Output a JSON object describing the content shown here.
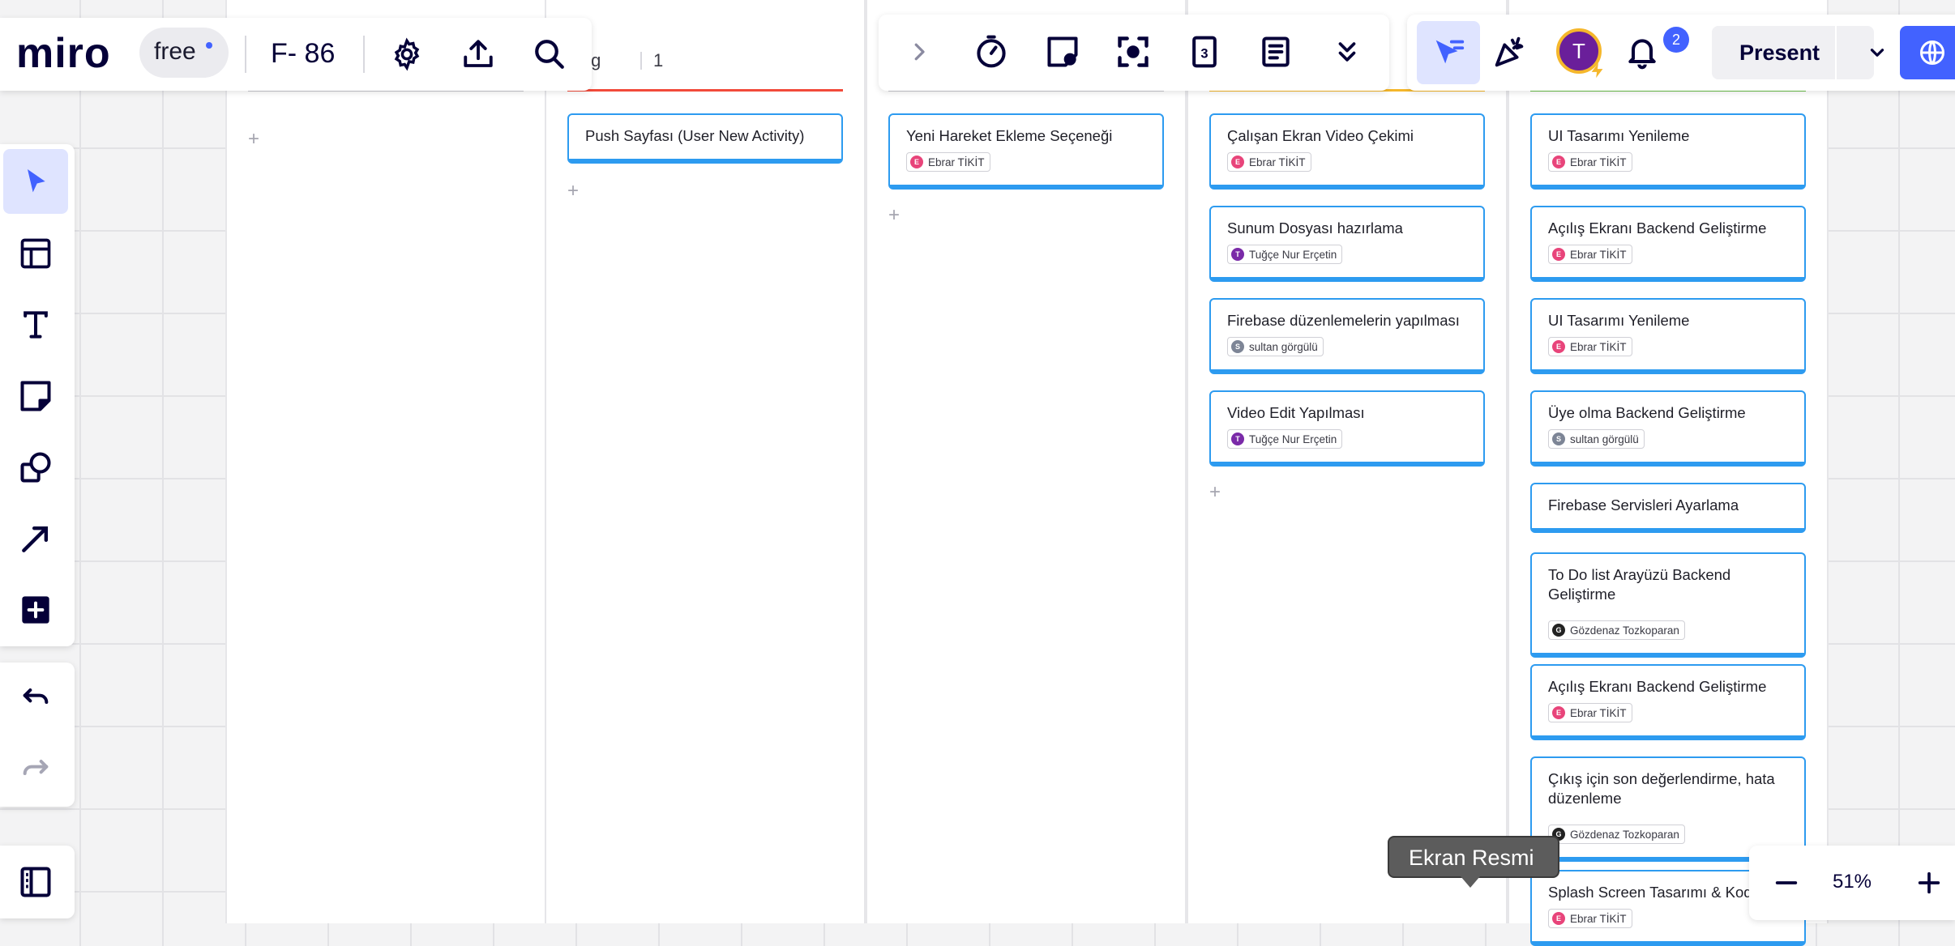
{
  "app": {
    "logo": "miro",
    "plan_badge": "free",
    "board_name": "F- 86"
  },
  "topbar_icons": [
    "settings-icon",
    "upload-icon",
    "search-icon"
  ],
  "collab_toolbar": {
    "icons": [
      "chevron-right-icon",
      "timer-icon",
      "sticky-vote-icon",
      "focus-icon",
      "card-count-icon",
      "notes-icon",
      "chevron-double-down-icon"
    ],
    "avatar_letter": "T",
    "notification_count": "2",
    "present_label": "Present"
  },
  "columns": [
    {
      "title": "",
      "count": "",
      "color": "#c7c7cf",
      "cards": []
    },
    {
      "title": "cklog",
      "count": "1",
      "color": "#f24a3a",
      "cards": [
        {
          "title": "Push Sayfası (User New Activity)",
          "assignee": ""
        }
      ]
    },
    {
      "title": "",
      "count": "",
      "color": "#c7c7cf",
      "cards": [
        {
          "title": "Yeni Hareket Ekleme Seçeneği",
          "assignee": "Ebrar TİKİT"
        }
      ]
    },
    {
      "title": "",
      "count": "",
      "color": "#f5b72b",
      "cards": [
        {
          "title": "Çalışan Ekran Video Çekimi",
          "assignee": "Ebrar TİKİT"
        },
        {
          "title": "Sunum Dosyası hazırlama",
          "assignee": "Tuğçe Nur Erçetin"
        },
        {
          "title": "Firebase düzenlemelerin yapılması",
          "assignee": "sultan görgülü"
        },
        {
          "title": "Video Edit Yapılması",
          "assignee": "Tuğçe Nur Erçetin"
        }
      ]
    },
    {
      "title": "",
      "count": "",
      "color": "#6cc24a",
      "cards": [
        {
          "title": "UI Tasarımı Yenileme",
          "assignee": "Ebrar TİKİT"
        },
        {
          "title": "Açılış Ekranı Backend Geliştirme",
          "assignee": "Ebrar TİKİT"
        },
        {
          "title": "UI Tasarımı Yenileme",
          "assignee": "Ebrar TİKİT"
        },
        {
          "title": "Üye olma Backend Geliştirme",
          "assignee": "sultan görgülü"
        },
        {
          "title": "Firebase Servisleri Ayarlama",
          "assignee": ""
        },
        {
          "title": "To Do list Arayüzü Backend Geliştirme",
          "assignee": "Gözdenaz Tozkoparan"
        },
        {
          "title": "Açılış Ekranı Backend Geliştirme",
          "assignee": "Ebrar TİKİT"
        },
        {
          "title": "Çıkış için son değerlendirme, hata düzenleme",
          "assignee": "Gözdenaz Tozkoparan"
        },
        {
          "title": "Splash Screen Tasarımı & Kodla",
          "assignee": "Ebrar TİKİT"
        }
      ]
    }
  ],
  "assignee_colors": {
    "Ebrar TİKİT": "#e8447a",
    "Tuğçe Nur Erçetin": "#7a2aa8",
    "sultan görgülü": "#7d8596",
    "Gözdenaz Tozkoparan": "#222222"
  },
  "left_toolbar": [
    "select-tool",
    "templates-tool",
    "text-tool",
    "sticky-note-tool",
    "shapes-tool",
    "connection-line-tool",
    "more-apps-tool"
  ],
  "tooltip": "Ekran Resmi",
  "zoom": {
    "level": "51%"
  }
}
